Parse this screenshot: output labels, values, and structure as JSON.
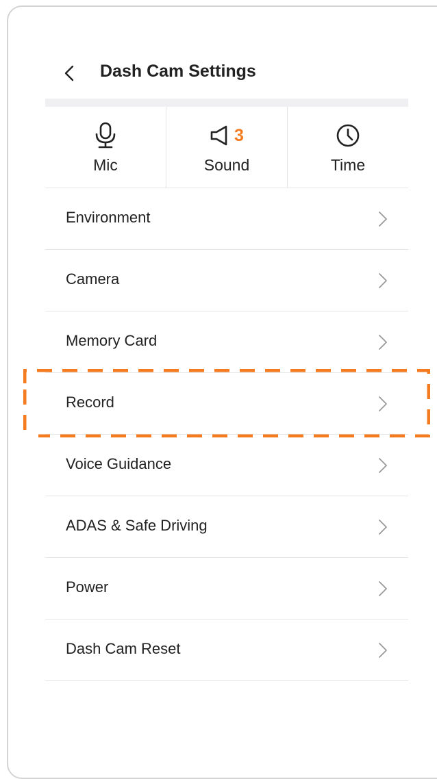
{
  "header": {
    "title": "Dash Cam Settings",
    "back_icon": "chevron-left-icon"
  },
  "quick_settings": [
    {
      "label": "Mic",
      "icon": "microphone-icon"
    },
    {
      "label": "Sound",
      "icon": "speaker-icon",
      "badge": "3"
    },
    {
      "label": "Time",
      "icon": "clock-icon"
    }
  ],
  "menu": {
    "items": [
      {
        "label": "Environment"
      },
      {
        "label": "Camera"
      },
      {
        "label": "Memory Card"
      },
      {
        "label": "Record"
      },
      {
        "label": "Voice Guidance"
      },
      {
        "label": "ADAS & Safe Driving"
      },
      {
        "label": "Power"
      },
      {
        "label": "Dash Cam Reset"
      }
    ],
    "highlighted_item": "Record"
  },
  "colors": {
    "accent": "#f47b20",
    "text": "#222222",
    "chevron": "#999999",
    "divider": "#e6e6e6"
  }
}
